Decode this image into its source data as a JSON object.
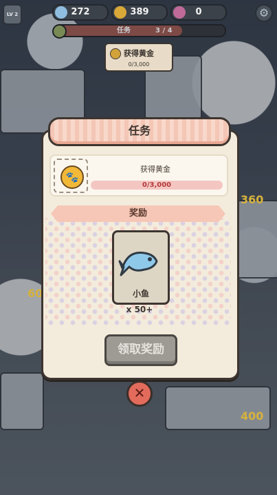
{
  "topbar": {
    "level": "LV 2",
    "fish_count": "272",
    "gold_count": "389",
    "gem_count": "0"
  },
  "task_progress": {
    "label": "任务",
    "count": "3 / 4",
    "fraction": 0.75
  },
  "gold_tooltip": {
    "title": "获得黄金",
    "progress": "0/3,000"
  },
  "side_values": {
    "right_top": "360",
    "right_bottom": "400",
    "left": "60"
  },
  "dialog": {
    "title": "任务",
    "task": {
      "name": "获得黄金",
      "progress": "0/3,000",
      "icon": "paw-coin-icon"
    },
    "reward_header": "奖励",
    "reward": {
      "name": "小鱼",
      "quantity": "x 50+",
      "icon": "fish-icon"
    },
    "claim_label": "领取奖励"
  },
  "colors": {
    "title_bar": "#f3c6b5",
    "dialog_bg": "#f3ecdc",
    "close_button": "#e26b5c",
    "claim_disabled": "#9e9a94"
  }
}
